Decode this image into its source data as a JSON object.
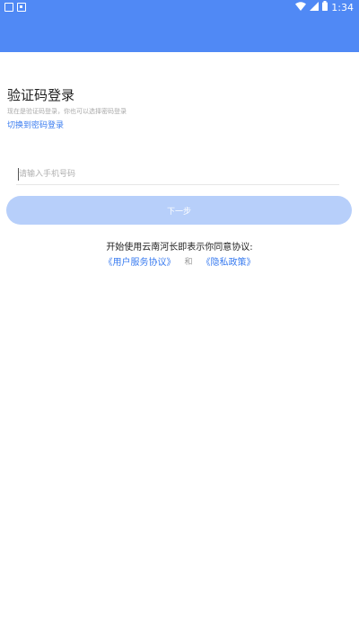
{
  "status_bar": {
    "time": "1:34",
    "icons": [
      "notification-icon",
      "notification-icon",
      "wifi-icon",
      "signal-icon",
      "battery-icon"
    ],
    "color": "#5089f5"
  },
  "login": {
    "title": "验证码登录",
    "subtitle": "现在是验证码登录，你也可以选择密码登录",
    "switch_link": "切换到密码登录",
    "phone_placeholder": "请输入手机号码",
    "next_button": "下一步"
  },
  "agreement": {
    "text": "开始使用云南河长即表示你同意协议:",
    "user_agreement": "《用户服务协议》",
    "and": "和",
    "privacy_policy": "《隐私政策》",
    "link_color": "#3a7cf0"
  }
}
